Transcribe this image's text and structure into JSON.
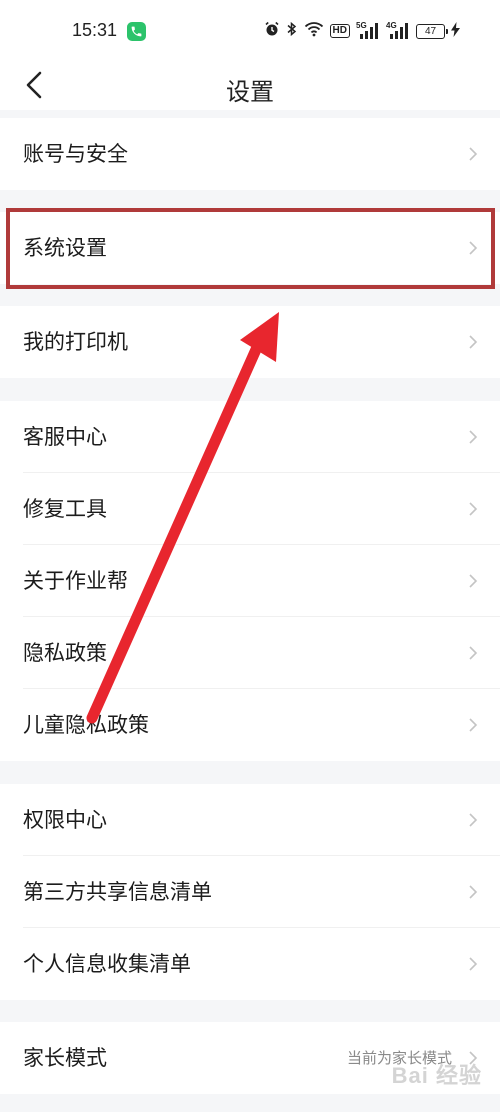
{
  "status_bar": {
    "time": "15:31",
    "hd_label": "HD",
    "signal_1_label": "5G",
    "signal_2_label": "4G",
    "battery": "47",
    "call_color": "#2cc36b"
  },
  "nav": {
    "title": "设置",
    "back_icon": "chevron-left-icon"
  },
  "groups": [
    {
      "items": [
        {
          "label": "账号与安全"
        }
      ]
    },
    {
      "items": [
        {
          "label": "系统设置"
        }
      ]
    },
    {
      "items": [
        {
          "label": "我的打印机"
        }
      ]
    },
    {
      "items": [
        {
          "label": "客服中心"
        },
        {
          "label": "修复工具"
        },
        {
          "label": "关于作业帮"
        },
        {
          "label": "隐私政策"
        },
        {
          "label": "儿童隐私政策"
        }
      ]
    },
    {
      "items": [
        {
          "label": "权限中心"
        },
        {
          "label": "第三方共享信息清单"
        },
        {
          "label": "个人信息收集清单"
        }
      ]
    },
    {
      "items": [
        {
          "label": "家长模式",
          "value": "当前为家长模式"
        }
      ]
    }
  ],
  "annotation": {
    "highlight_color": "#b03a3a",
    "arrow_color": "#e8262e"
  },
  "watermark": "Bai 经验"
}
